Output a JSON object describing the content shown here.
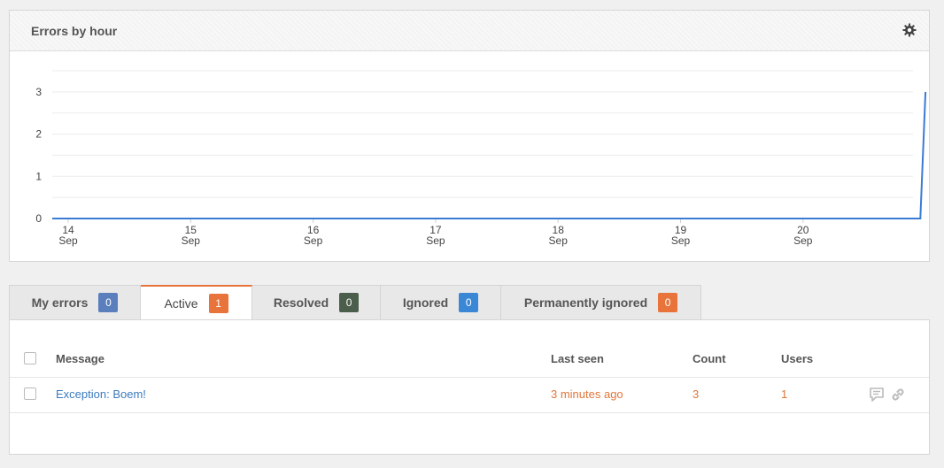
{
  "panel": {
    "title": "Errors by hour"
  },
  "chart_data": {
    "type": "line",
    "x_ticks": [
      {
        "day": "14",
        "month": "Sep"
      },
      {
        "day": "15",
        "month": "Sep"
      },
      {
        "day": "16",
        "month": "Sep"
      },
      {
        "day": "17",
        "month": "Sep"
      },
      {
        "day": "18",
        "month": "Sep"
      },
      {
        "day": "19",
        "month": "Sep"
      },
      {
        "day": "20",
        "month": "Sep"
      }
    ],
    "y_ticks": [
      "0",
      "1",
      "2",
      "3"
    ],
    "ylim": [
      0,
      3.5
    ],
    "series": [
      {
        "values": [
          {
            "x": "14 Sep 00:00",
            "y": 0
          },
          {
            "x": "20 Sep 23:00",
            "y": 0
          },
          {
            "x": "21 Sep 00:00",
            "y": 3
          }
        ]
      }
    ],
    "line_color": "#3a7bd5",
    "grid": true
  },
  "tabs": [
    {
      "label": "My errors",
      "count": "0",
      "color": "#5b7fbd"
    },
    {
      "label": "Active",
      "count": "1",
      "color": "#e8743b"
    },
    {
      "label": "Resolved",
      "count": "0",
      "color": "#4b5e4c"
    },
    {
      "label": "Ignored",
      "count": "0",
      "color": "#3a87d6"
    },
    {
      "label": "Permanently ignored",
      "count": "0",
      "color": "#e8743b"
    }
  ],
  "table": {
    "headers": {
      "message": "Message",
      "last_seen": "Last seen",
      "count": "Count",
      "users": "Users"
    },
    "rows": [
      {
        "message": "Exception: Boem!",
        "last_seen": "3 minutes ago",
        "count": "3",
        "users": "1"
      }
    ]
  }
}
